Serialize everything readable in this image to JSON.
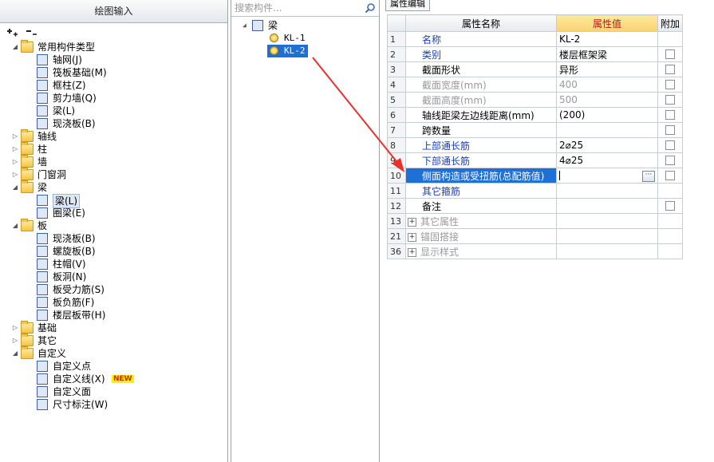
{
  "left_panel": {
    "title": "绘图输入",
    "toolbar": {
      "expand_all": "+",
      "collapse_all": "−"
    },
    "tree": [
      {
        "label": "常用构件类型",
        "level": 0,
        "type": "folder",
        "expanded": true
      },
      {
        "label": "轴网(J)",
        "level": 1,
        "type": "item",
        "icon": "grid-icon"
      },
      {
        "label": "筏板基础(M)",
        "level": 1,
        "type": "item",
        "icon": "raft-foundation-icon"
      },
      {
        "label": "框柱(Z)",
        "level": 1,
        "type": "item",
        "icon": "column-icon"
      },
      {
        "label": "剪力墙(Q)",
        "level": 1,
        "type": "item",
        "icon": "shear-wall-icon"
      },
      {
        "label": "梁(L)",
        "level": 1,
        "type": "item",
        "icon": "beam-icon"
      },
      {
        "label": "现浇板(B)",
        "level": 1,
        "type": "item",
        "icon": "slab-icon"
      },
      {
        "label": "轴线",
        "level": 0,
        "type": "folder",
        "expanded": false
      },
      {
        "label": "柱",
        "level": 0,
        "type": "folder",
        "expanded": false
      },
      {
        "label": "墙",
        "level": 0,
        "type": "folder",
        "expanded": false
      },
      {
        "label": "门窗洞",
        "level": 0,
        "type": "folder",
        "expanded": false
      },
      {
        "label": "梁",
        "level": 0,
        "type": "folder",
        "expanded": true
      },
      {
        "label": "梁(L)",
        "level": 1,
        "type": "item",
        "icon": "beam-icon",
        "selected": true
      },
      {
        "label": "圈梁(E)",
        "level": 1,
        "type": "item",
        "icon": "ring-beam-icon"
      },
      {
        "label": "板",
        "level": 0,
        "type": "folder",
        "expanded": true
      },
      {
        "label": "现浇板(B)",
        "level": 1,
        "type": "item",
        "icon": "slab-icon"
      },
      {
        "label": "螺旋板(B)",
        "level": 1,
        "type": "item",
        "icon": "spiral-slab-icon"
      },
      {
        "label": "柱帽(V)",
        "level": 1,
        "type": "item",
        "icon": "column-cap-icon"
      },
      {
        "label": "板洞(N)",
        "level": 1,
        "type": "item",
        "icon": "slab-hole-icon"
      },
      {
        "label": "板受力筋(S)",
        "level": 1,
        "type": "item",
        "icon": "slab-rebar-icon"
      },
      {
        "label": "板负筋(F)",
        "level": 1,
        "type": "item",
        "icon": "negative-rebar-icon"
      },
      {
        "label": "楼层板带(H)",
        "level": 1,
        "type": "item",
        "icon": "slab-strip-icon"
      },
      {
        "label": "基础",
        "level": 0,
        "type": "folder",
        "expanded": false
      },
      {
        "label": "其它",
        "level": 0,
        "type": "folder",
        "expanded": false
      },
      {
        "label": "自定义",
        "level": 0,
        "type": "folder",
        "expanded": true
      },
      {
        "label": "自定义点",
        "level": 1,
        "type": "item",
        "icon": "custom-point-icon"
      },
      {
        "label": "自定义线(X)",
        "level": 1,
        "type": "item",
        "icon": "custom-line-icon",
        "badge": "NEW"
      },
      {
        "label": "自定义面",
        "level": 1,
        "type": "item",
        "icon": "custom-area-icon"
      },
      {
        "label": "尺寸标注(W)",
        "level": 1,
        "type": "item",
        "icon": "dimension-icon"
      }
    ]
  },
  "middle_panel": {
    "search_placeholder": "搜索构件...",
    "tree": [
      {
        "label": "梁",
        "level": 0,
        "expanded": true
      },
      {
        "label": "KL-1",
        "level": 1,
        "selected": false
      },
      {
        "label": "KL-2",
        "level": 1,
        "selected": true
      }
    ]
  },
  "right_panel": {
    "tab_label": "属性编辑",
    "headers": {
      "name": "属性名称",
      "value": "属性值",
      "extra": "附加"
    },
    "rows": [
      {
        "num": "1",
        "name": "名称",
        "value": "KL-2",
        "name_style": "blue",
        "checkbox": false
      },
      {
        "num": "2",
        "name": "类别",
        "value": "楼层框架梁",
        "name_style": "blue",
        "checkbox": true
      },
      {
        "num": "3",
        "name": "截面形状",
        "value": "异形",
        "name_style": "black",
        "checkbox": true
      },
      {
        "num": "4",
        "name": "截面宽度(mm)",
        "value": "400",
        "name_style": "gray",
        "checkbox": true
      },
      {
        "num": "5",
        "name": "截面高度(mm)",
        "value": "500",
        "name_style": "gray",
        "checkbox": true
      },
      {
        "num": "6",
        "name": "轴线距梁左边线距离(mm)",
        "value": "(200)",
        "name_style": "black",
        "checkbox": true
      },
      {
        "num": "7",
        "name": "跨数量",
        "value": "",
        "name_style": "black",
        "checkbox": true
      },
      {
        "num": "8",
        "name": "上部通长筋",
        "value": "2⌀25",
        "name_style": "blue",
        "checkbox": true
      },
      {
        "num": "9",
        "name": "下部通长筋",
        "value": "4⌀25",
        "name_style": "blue",
        "checkbox": true
      },
      {
        "num": "10",
        "name": "侧面构造或受扭筋(总配筋值)",
        "value": "",
        "name_style": "active",
        "checkbox": true,
        "editing": true
      },
      {
        "num": "11",
        "name": "其它箍筋",
        "value": "",
        "name_style": "blue",
        "checkbox": false
      },
      {
        "num": "12",
        "name": "备注",
        "value": "",
        "name_style": "black",
        "checkbox": true
      },
      {
        "num": "13",
        "name": "其它属性",
        "value": "",
        "name_style": "group",
        "checkbox": false,
        "group": true
      },
      {
        "num": "21",
        "name": "锚固搭接",
        "value": "",
        "name_style": "group",
        "checkbox": false,
        "group": true
      },
      {
        "num": "36",
        "name": "显示样式",
        "value": "",
        "name_style": "group",
        "checkbox": false,
        "group": true
      }
    ]
  },
  "colors": {
    "selection_blue": "#1e6fd6",
    "header_value_bg": "#fbd36a",
    "header_value_text": "#b2181a",
    "link_blue": "#1b3fb0",
    "annotation_arrow": "#e8312f",
    "new_badge": "#fff200"
  }
}
